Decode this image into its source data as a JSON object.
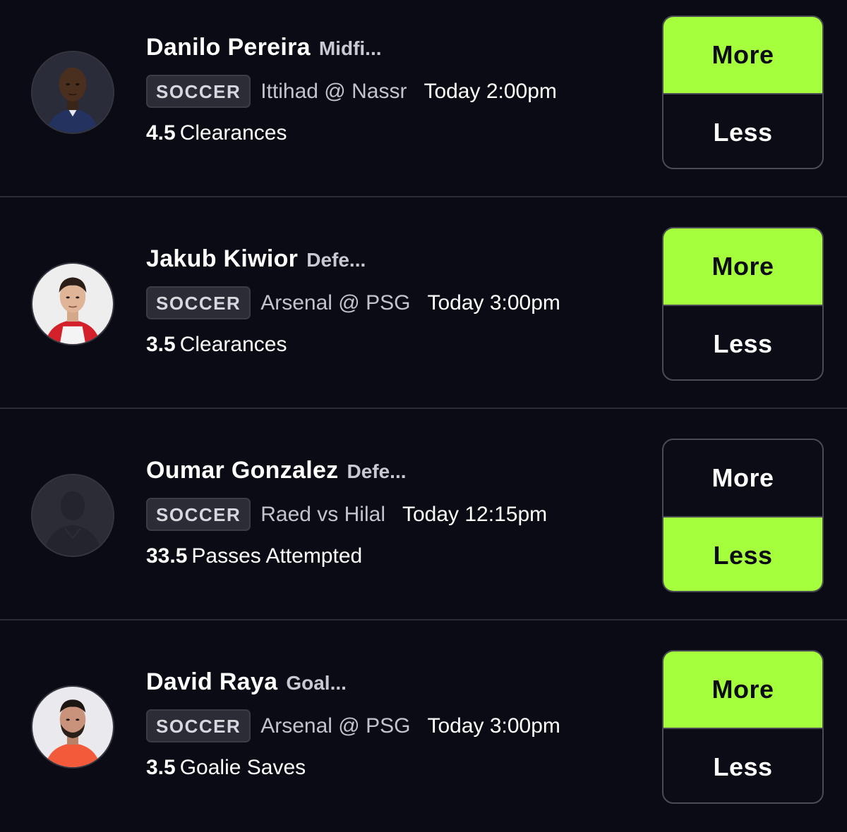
{
  "accent_color": "#a6ff3c",
  "background_color": "#0a0b14",
  "projections": [
    {
      "player_name": "Danilo Pereira",
      "position": "Midfi...",
      "sport": "SOCCER",
      "matchup": "Ittihad @ Nassr",
      "game_time": "Today 2:00pm",
      "line": "4.5",
      "stat": "Clearances",
      "more_label": "More",
      "less_label": "Less",
      "selected_pick": "More",
      "avatar": "player-photo"
    },
    {
      "player_name": "Jakub Kiwior",
      "position": "Defe...",
      "sport": "SOCCER",
      "matchup": "Arsenal @ PSG",
      "game_time": "Today 3:00pm",
      "line": "3.5",
      "stat": "Clearances",
      "more_label": "More",
      "less_label": "Less",
      "selected_pick": "More",
      "avatar": "player-photo"
    },
    {
      "player_name": "Oumar Gonzalez",
      "position": "Defe...",
      "sport": "SOCCER",
      "matchup": "Raed vs Hilal",
      "game_time": "Today 12:15pm",
      "line": "33.5",
      "stat": "Passes Attempted",
      "more_label": "More",
      "less_label": "Less",
      "selected_pick": "Less",
      "avatar": "placeholder-silhouette"
    },
    {
      "player_name": "David Raya",
      "position": "Goal...",
      "sport": "SOCCER",
      "matchup": "Arsenal @ PSG",
      "game_time": "Today 3:00pm",
      "line": "3.5",
      "stat": "Goalie Saves",
      "more_label": "More",
      "less_label": "Less",
      "selected_pick": "More",
      "avatar": "player-photo"
    }
  ]
}
